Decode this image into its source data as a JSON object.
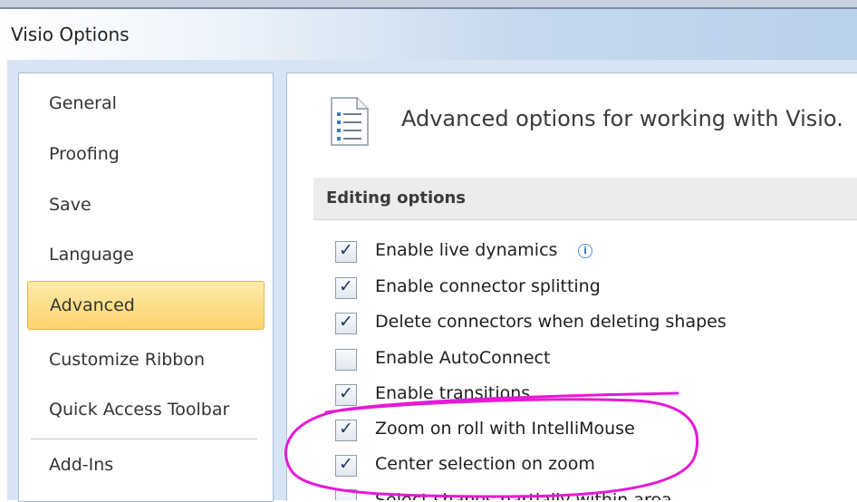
{
  "window": {
    "title": "Visio Options"
  },
  "nav": {
    "items": [
      {
        "label": "General",
        "active": false
      },
      {
        "label": "Proofing",
        "active": false
      },
      {
        "label": "Save",
        "active": false
      },
      {
        "label": "Language",
        "active": false
      },
      {
        "label": "Advanced",
        "active": true
      },
      {
        "label": "Customize Ribbon",
        "active": false
      },
      {
        "label": "Quick Access Toolbar",
        "active": false
      },
      {
        "label": "Add-Ins",
        "active": false
      }
    ]
  },
  "main": {
    "header_text": "Advanced options for working with Visio.",
    "section_title": "Editing options",
    "options": [
      {
        "label": "Enable live dynamics",
        "checked": true,
        "info": true
      },
      {
        "label": "Enable connector splitting",
        "checked": true
      },
      {
        "label": "Delete connectors when deleting shapes",
        "checked": true
      },
      {
        "label": "Enable AutoConnect",
        "checked": false
      },
      {
        "label": "Enable transitions",
        "checked": true
      },
      {
        "label": "Zoom on roll with IntelliMouse",
        "checked": true
      },
      {
        "label": "Center selection on zoom",
        "checked": true
      }
    ],
    "cutoff_option": "Select shapes partially within area"
  },
  "annotation": {
    "color": "#e619d6",
    "shape": "hand-drawn ellipse"
  }
}
